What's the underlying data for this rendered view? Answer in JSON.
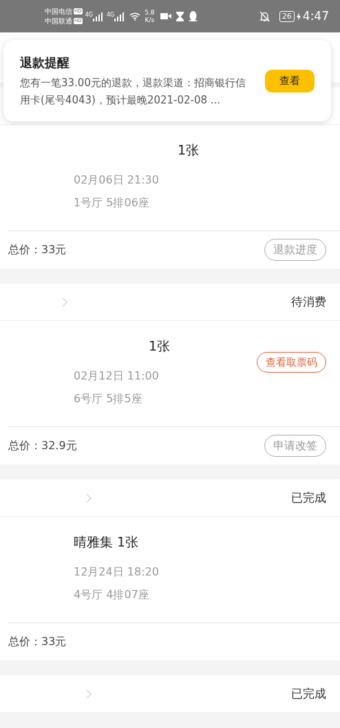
{
  "status_bar": {
    "carriers": [
      {
        "name": "中国电信",
        "badge": "HD"
      },
      {
        "name": "中国联通",
        "badge": "HD"
      }
    ],
    "networks": [
      "4G",
      "4G"
    ],
    "speed_value": "5.8",
    "speed_unit": "K/s",
    "battery": "26",
    "time": "4:47"
  },
  "notification": {
    "title": "退款提醒",
    "body": "您有一笔33.00元的退款，退款渠道：招商银行信用卡(尾号4043)，预计最晚2021-02-08 ...",
    "button": "查看"
  },
  "orders": [
    {
      "title": "1张",
      "datetime": "02月06日 21:30",
      "seat": "1号厅 5排06座",
      "total": "总价：33元",
      "action": "退款进度"
    },
    {
      "status": "待消费",
      "title": "1张",
      "datetime": "02月12日 11:00",
      "seat": "6号厅 5排5座",
      "ticket_button": "查看取票码",
      "total": "总价：32.9元",
      "action": "申请改签"
    },
    {
      "status": "已完成",
      "title": "晴雅集 1张",
      "datetime": "12月24日 18:20",
      "seat": "4号厅 4排07座",
      "total": "总价：33元"
    },
    {
      "status": "已完成"
    }
  ]
}
